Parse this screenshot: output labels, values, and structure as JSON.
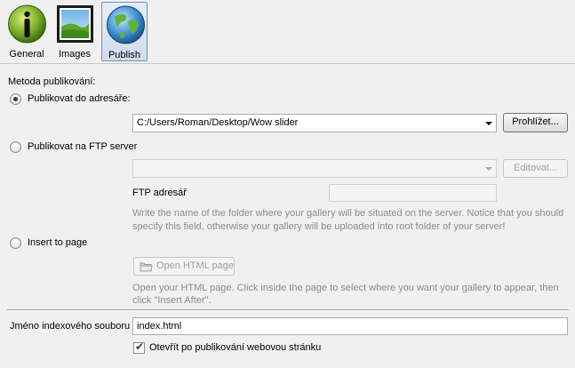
{
  "toolbar": {
    "tabs": [
      {
        "label": "General",
        "icon": "info-icon",
        "active": false
      },
      {
        "label": "Images",
        "icon": "image-icon",
        "active": false
      },
      {
        "label": "Publish",
        "icon": "globe-icon",
        "active": true
      }
    ]
  },
  "publish": {
    "method_label": "Metoda publikování:",
    "option_folder": {
      "label": "Publikovat do adresáře:",
      "checked": true,
      "path_value": "C:/Users/Roman/Desktop/Wow slider",
      "browse_label": "Prohlížet..."
    },
    "option_ftp": {
      "label": "Publikovat na FTP server",
      "checked": false,
      "server_value": "",
      "edit_label": "Editovat...",
      "ftp_folder_label": "FTP adresář",
      "ftp_folder_value": "",
      "hint_line1": "Write the name of the folder where your gallery will be situated on the server. Notice that you should",
      "hint_line2": "specify this field, otherwise your gallery will be uploaded into root folder of your server!"
    },
    "option_insert": {
      "label": "Insert to page",
      "checked": false,
      "open_html_label": "Open HTML page",
      "hint_line1": "Open your HTML page. Click inside the page to select where you want your gallery to appear, then",
      "hint_line2": "click \"Insert After\"."
    },
    "index_file_label": "Jméno indexového souboru",
    "index_file_value": "index.html",
    "open_after_label": "Otevřít po publikování webovou stránku",
    "open_after_checked": true
  },
  "colors": {
    "accent": "#1d3e6e",
    "hint": "#8c8c8c"
  }
}
